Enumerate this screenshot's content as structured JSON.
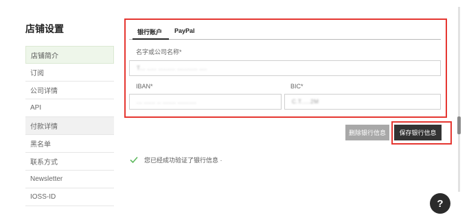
{
  "sidebar": {
    "title": "店铺设置",
    "items": [
      {
        "label": "店铺简介"
      },
      {
        "label": "订阅"
      },
      {
        "label": "公司详情"
      },
      {
        "label": "API"
      },
      {
        "label": "付款详情"
      },
      {
        "label": "黑名单"
      },
      {
        "label": "联系方式"
      },
      {
        "label": "Newsletter"
      },
      {
        "label": "IOSS-ID"
      }
    ]
  },
  "bank": {
    "tabs": [
      {
        "label": "银行账户"
      },
      {
        "label": "PayPal"
      }
    ],
    "name_label": "名字或公司名称*",
    "name_value": "T... ..... ......... ...........  ....",
    "iban_label": "IBAN*",
    "iban_value": "... ...... .. ....... ..........",
    "bic_label": "BIC*",
    "bic_value": "C.T.....2M"
  },
  "actions": {
    "delete_label": "删除银行信息",
    "save_label": "保存银行信息"
  },
  "status": {
    "success_text": "您已经成功验证了银行信息 ·"
  },
  "help": {
    "label": "?"
  },
  "colors": {
    "highlight": "#e5352f",
    "success": "#5cb85c",
    "save_button": "#333333",
    "delete_button": "#a8a8a8"
  }
}
